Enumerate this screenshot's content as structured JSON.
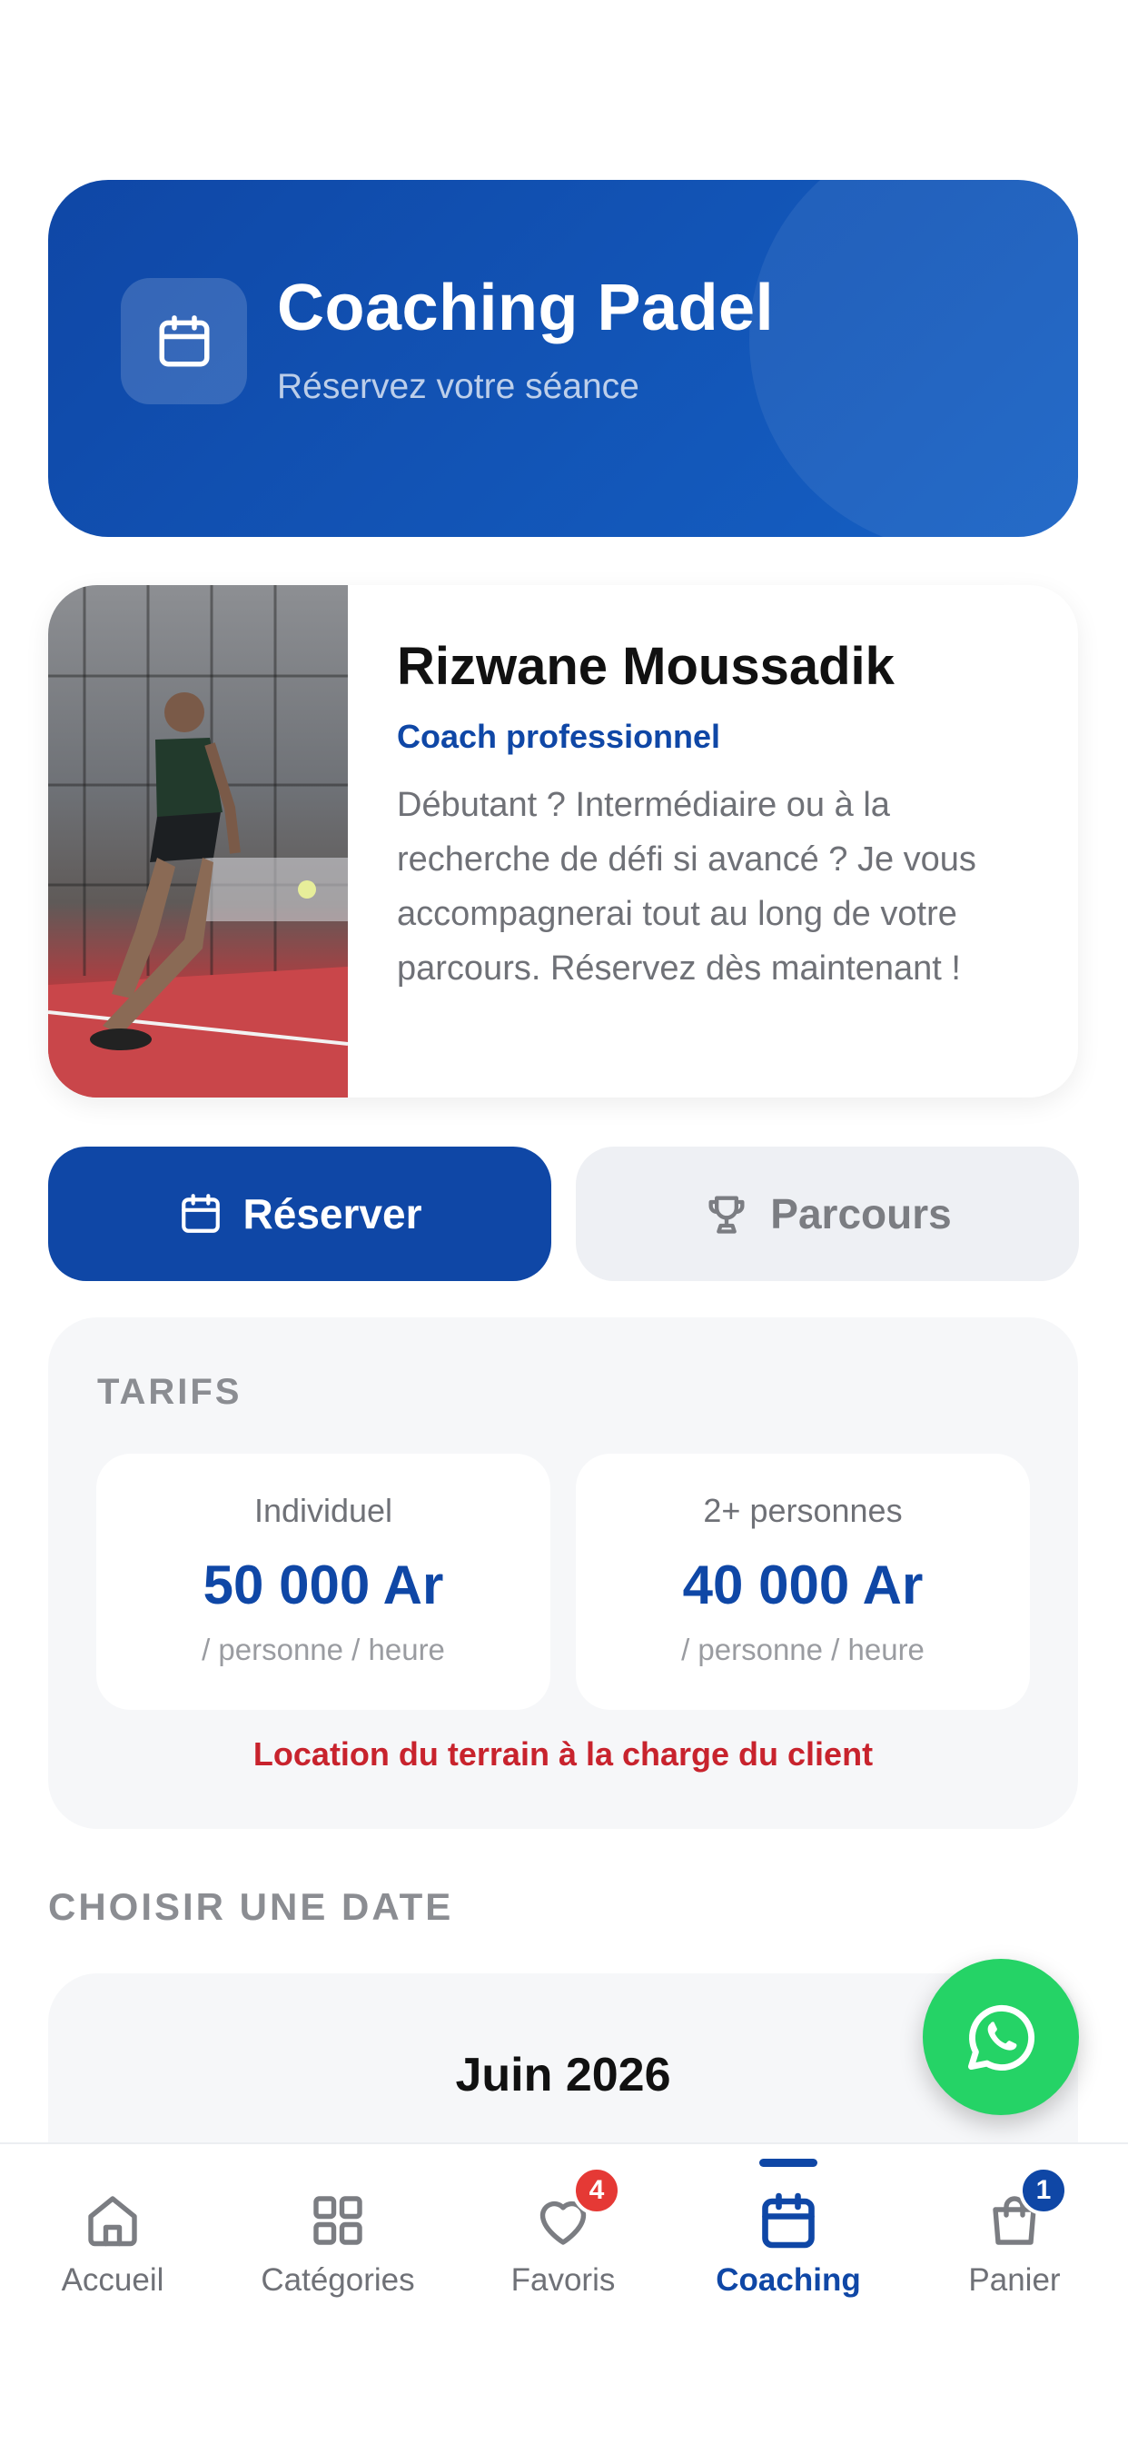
{
  "header": {
    "title": "Coaching Padel",
    "subtitle": "Réservez votre séance",
    "icon": "calendar-icon"
  },
  "coach": {
    "name": "Rizwane Moussadik",
    "role": "Coach professionnel",
    "description": "Débutant ? Intermédiaire ou à la recherche de défi si avancé ? Je vous accompagnerai tout au long de votre parcours. Réservez dès maintenant !"
  },
  "actions": {
    "reserve_label": "Réserver",
    "parcours_label": "Parcours"
  },
  "tarifs": {
    "title": "TARIFS",
    "options": [
      {
        "label": "Individuel",
        "amount": "50 000 Ar",
        "unit": "/ personne / heure"
      },
      {
        "label": "2+ personnes",
        "amount": "40 000 Ar",
        "unit": "/ personne / heure"
      }
    ],
    "note": "Location du terrain à la charge du client"
  },
  "date_picker": {
    "title": "CHOISIR UNE DATE",
    "month": "Juin 2026"
  },
  "nav": {
    "items": [
      {
        "label": "Accueil",
        "icon": "home-icon"
      },
      {
        "label": "Catégories",
        "icon": "grid-icon"
      },
      {
        "label": "Favoris",
        "icon": "heart-icon",
        "badge": "4"
      },
      {
        "label": "Coaching",
        "icon": "calendar-icon",
        "active": true
      },
      {
        "label": "Panier",
        "icon": "bag-icon",
        "badge": "1"
      }
    ]
  },
  "colors": {
    "primary": "#0f47a6",
    "whatsapp": "#25d366",
    "alert": "#c8232d",
    "badge_red": "#e53935"
  }
}
